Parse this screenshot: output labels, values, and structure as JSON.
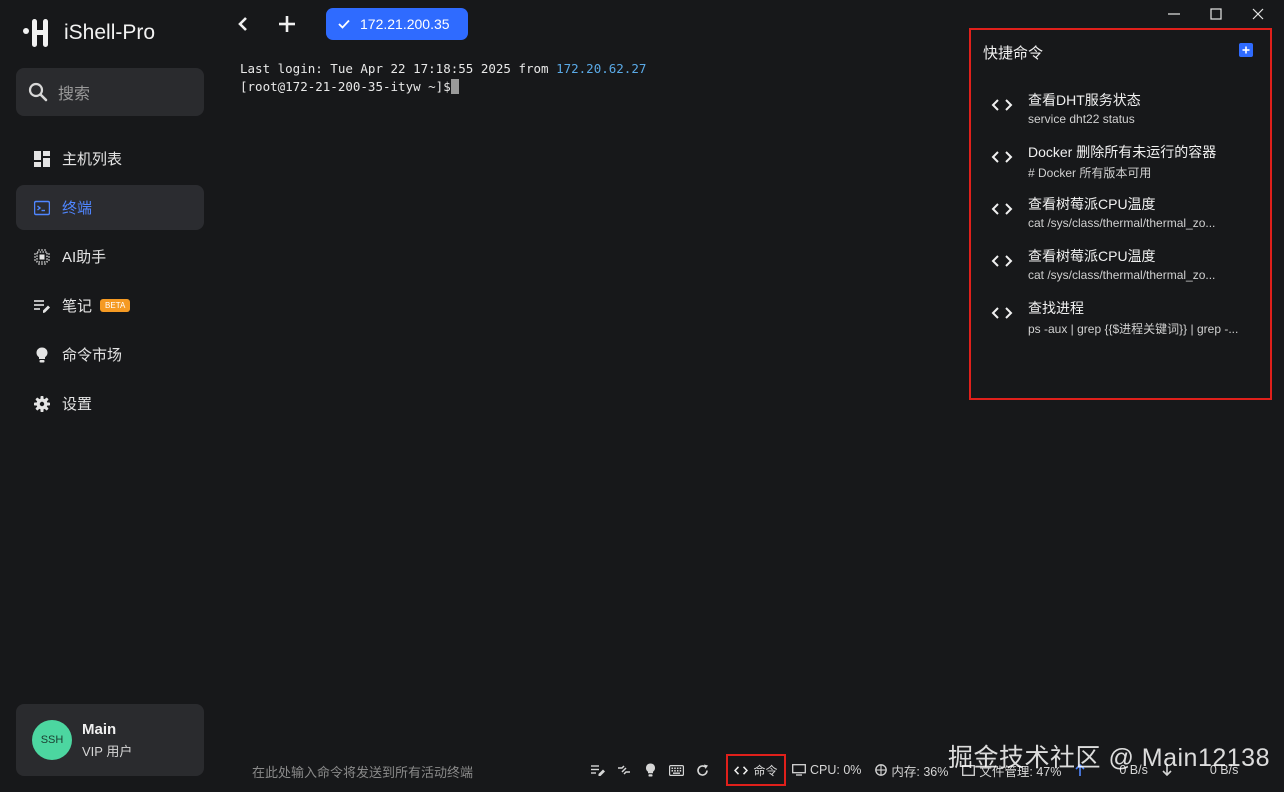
{
  "app": {
    "name": "iShell-Pro"
  },
  "sidebar": {
    "search_placeholder": "搜索",
    "items": [
      {
        "label": "主机列表",
        "icon": "dashboard-icon",
        "active": false
      },
      {
        "label": "终端",
        "icon": "terminal-icon",
        "active": true
      },
      {
        "label": "AI助手",
        "icon": "ai-chip-icon",
        "active": false
      },
      {
        "label": "笔记",
        "icon": "note-edit-icon",
        "active": false,
        "badge": "BETA"
      },
      {
        "label": "命令市场",
        "icon": "lightbulb-icon",
        "active": false
      },
      {
        "label": "设置",
        "icon": "gear-icon",
        "active": false
      }
    ],
    "user": {
      "avatar_text": "SSH",
      "name": "Main",
      "role": "VIP 用户"
    }
  },
  "topbar": {
    "session_tab_label": "172.21.200.35"
  },
  "terminal": {
    "line1_prefix": "Last login: Tue Apr 22 17:18:55 2025 from ",
    "line1_ip": "172.20.62.27",
    "prompt": "[root@172-21-200-35-ityw ~]$"
  },
  "quick_commands": {
    "title": "快捷命令",
    "items": [
      {
        "name": "查看DHT服务状态",
        "command": "service dht22 status"
      },
      {
        "name": "Docker 删除所有未运行的容器",
        "command": "# Docker 所有版本可用"
      },
      {
        "name": "查看树莓派CPU温度",
        "command": "cat /sys/class/thermal/thermal_zo..."
      },
      {
        "name": "查看树莓派CPU温度",
        "command": "cat /sys/class/thermal/thermal_zo..."
      },
      {
        "name": "查找进程",
        "command": "ps -aux | grep {{$进程关键词}} | grep -..."
      }
    ]
  },
  "bottom": {
    "broadcast_placeholder": "在此处输入命令将发送到所有活动终端",
    "command_label": "命令",
    "cpu": "CPU: 0%",
    "memory": "内存: 36%",
    "file_mgmt": "文件管理: 47%",
    "upload_speed": "0 B/s",
    "download_speed": "0 B/s"
  },
  "watermark": "掘金技术社区 @ Main12138",
  "colors": {
    "accent": "#2f6bff",
    "highlight_border": "#e0201b",
    "background": "#17181a"
  }
}
